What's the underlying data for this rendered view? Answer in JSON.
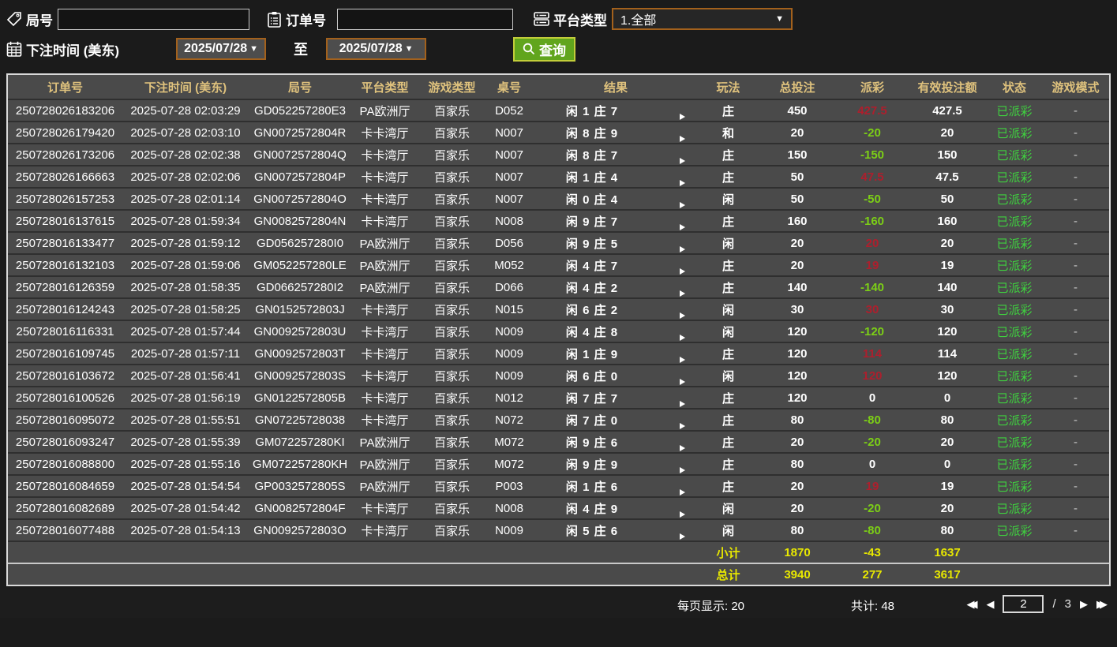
{
  "filters": {
    "game_no_label": "局号",
    "game_no_value": "",
    "order_no_label": "订单号",
    "order_no_value": "",
    "platform_label": "平台类型",
    "platform_value": "1.全部",
    "bet_time_label": "下注时间 (美东)",
    "date_from": "2025/07/28",
    "to_label": "至",
    "date_to": "2025/07/28",
    "search_label": "查询"
  },
  "colors": {
    "header_text": "#dfc27d",
    "win_red": "#ad1f2d",
    "loss_green": "#7ccf16",
    "status_green": "#3fd13f",
    "total_yellow": "#e8e800",
    "button_green": "#61a51d",
    "filter_border_orange": "#a3611c",
    "row_bg": "#4a4a4a",
    "page_bg": "#1b1b1b"
  },
  "table": {
    "headers": [
      "订单号",
      "下注时间 (美东)",
      "局号",
      "平台类型",
      "游戏类型",
      "桌号",
      "结果",
      "玩法",
      "总投注",
      "派彩",
      "有效投注额",
      "状态",
      "游戏模式"
    ],
    "rows": [
      {
        "order_id": "250728026183206",
        "bet_time": "2025-07-28 02:03:29",
        "game_no": "GD052257280E3",
        "platform": "PA欧洲厅",
        "game_type": "百家乐",
        "table_no": "D052",
        "result": "闲 1 庄 7",
        "play": "庄",
        "total_bet": "450",
        "payout": "427.5",
        "payout_color": "red",
        "valid_bet": "427.5",
        "status": "已派彩",
        "game_mode": "-"
      },
      {
        "order_id": "250728026179420",
        "bet_time": "2025-07-28 02:03:10",
        "game_no": "GN0072572804R",
        "platform": "卡卡湾厅",
        "game_type": "百家乐",
        "table_no": "N007",
        "result": "闲 8 庄 9",
        "play": "和",
        "total_bet": "20",
        "payout": "-20",
        "payout_color": "green",
        "valid_bet": "20",
        "status": "已派彩",
        "game_mode": "-"
      },
      {
        "order_id": "250728026173206",
        "bet_time": "2025-07-28 02:02:38",
        "game_no": "GN0072572804Q",
        "platform": "卡卡湾厅",
        "game_type": "百家乐",
        "table_no": "N007",
        "result": "闲 8 庄 7",
        "play": "庄",
        "total_bet": "150",
        "payout": "-150",
        "payout_color": "green",
        "valid_bet": "150",
        "status": "已派彩",
        "game_mode": "-"
      },
      {
        "order_id": "250728026166663",
        "bet_time": "2025-07-28 02:02:06",
        "game_no": "GN0072572804P",
        "platform": "卡卡湾厅",
        "game_type": "百家乐",
        "table_no": "N007",
        "result": "闲 1 庄 4",
        "play": "庄",
        "total_bet": "50",
        "payout": "47.5",
        "payout_color": "red",
        "valid_bet": "47.5",
        "status": "已派彩",
        "game_mode": "-"
      },
      {
        "order_id": "250728026157253",
        "bet_time": "2025-07-28 02:01:14",
        "game_no": "GN0072572804O",
        "platform": "卡卡湾厅",
        "game_type": "百家乐",
        "table_no": "N007",
        "result": "闲 0 庄 4",
        "play": "闲",
        "total_bet": "50",
        "payout": "-50",
        "payout_color": "green",
        "valid_bet": "50",
        "status": "已派彩",
        "game_mode": "-"
      },
      {
        "order_id": "250728016137615",
        "bet_time": "2025-07-28 01:59:34",
        "game_no": "GN0082572804N",
        "platform": "卡卡湾厅",
        "game_type": "百家乐",
        "table_no": "N008",
        "result": "闲 9 庄 7",
        "play": "庄",
        "total_bet": "160",
        "payout": "-160",
        "payout_color": "green",
        "valid_bet": "160",
        "status": "已派彩",
        "game_mode": "-"
      },
      {
        "order_id": "250728016133477",
        "bet_time": "2025-07-28 01:59:12",
        "game_no": "GD056257280I0",
        "platform": "PA欧洲厅",
        "game_type": "百家乐",
        "table_no": "D056",
        "result": "闲 9 庄 5",
        "play": "闲",
        "total_bet": "20",
        "payout": "20",
        "payout_color": "red",
        "valid_bet": "20",
        "status": "已派彩",
        "game_mode": "-"
      },
      {
        "order_id": "250728016132103",
        "bet_time": "2025-07-28 01:59:06",
        "game_no": "GM052257280LE",
        "platform": "PA欧洲厅",
        "game_type": "百家乐",
        "table_no": "M052",
        "result": "闲 4 庄 7",
        "play": "庄",
        "total_bet": "20",
        "payout": "19",
        "payout_color": "red",
        "valid_bet": "19",
        "status": "已派彩",
        "game_mode": "-"
      },
      {
        "order_id": "250728016126359",
        "bet_time": "2025-07-28 01:58:35",
        "game_no": "GD066257280I2",
        "platform": "PA欧洲厅",
        "game_type": "百家乐",
        "table_no": "D066",
        "result": "闲 4 庄 2",
        "play": "庄",
        "total_bet": "140",
        "payout": "-140",
        "payout_color": "green",
        "valid_bet": "140",
        "status": "已派彩",
        "game_mode": "-"
      },
      {
        "order_id": "250728016124243",
        "bet_time": "2025-07-28 01:58:25",
        "game_no": "GN0152572803J",
        "platform": "卡卡湾厅",
        "game_type": "百家乐",
        "table_no": "N015",
        "result": "闲 6 庄 2",
        "play": "闲",
        "total_bet": "30",
        "payout": "30",
        "payout_color": "red",
        "valid_bet": "30",
        "status": "已派彩",
        "game_mode": "-"
      },
      {
        "order_id": "250728016116331",
        "bet_time": "2025-07-28 01:57:44",
        "game_no": "GN0092572803U",
        "platform": "卡卡湾厅",
        "game_type": "百家乐",
        "table_no": "N009",
        "result": "闲 4 庄 8",
        "play": "闲",
        "total_bet": "120",
        "payout": "-120",
        "payout_color": "green",
        "valid_bet": "120",
        "status": "已派彩",
        "game_mode": "-"
      },
      {
        "order_id": "250728016109745",
        "bet_time": "2025-07-28 01:57:11",
        "game_no": "GN0092572803T",
        "platform": "卡卡湾厅",
        "game_type": "百家乐",
        "table_no": "N009",
        "result": "闲 1 庄 9",
        "play": "庄",
        "total_bet": "120",
        "payout": "114",
        "payout_color": "red",
        "valid_bet": "114",
        "status": "已派彩",
        "game_mode": "-"
      },
      {
        "order_id": "250728016103672",
        "bet_time": "2025-07-28 01:56:41",
        "game_no": "GN0092572803S",
        "platform": "卡卡湾厅",
        "game_type": "百家乐",
        "table_no": "N009",
        "result": "闲 6 庄 0",
        "play": "闲",
        "total_bet": "120",
        "payout": "120",
        "payout_color": "red",
        "valid_bet": "120",
        "status": "已派彩",
        "game_mode": "-"
      },
      {
        "order_id": "250728016100526",
        "bet_time": "2025-07-28 01:56:19",
        "game_no": "GN0122572805B",
        "platform": "卡卡湾厅",
        "game_type": "百家乐",
        "table_no": "N012",
        "result": "闲 7 庄 7",
        "play": "庄",
        "total_bet": "120",
        "payout": "0",
        "payout_color": "white",
        "valid_bet": "0",
        "status": "已派彩",
        "game_mode": "-"
      },
      {
        "order_id": "250728016095072",
        "bet_time": "2025-07-28 01:55:51",
        "game_no": "GN07225728038",
        "platform": "卡卡湾厅",
        "game_type": "百家乐",
        "table_no": "N072",
        "result": "闲 7 庄 0",
        "play": "庄",
        "total_bet": "80",
        "payout": "-80",
        "payout_color": "green",
        "valid_bet": "80",
        "status": "已派彩",
        "game_mode": "-"
      },
      {
        "order_id": "250728016093247",
        "bet_time": "2025-07-28 01:55:39",
        "game_no": "GM072257280KI",
        "platform": "PA欧洲厅",
        "game_type": "百家乐",
        "table_no": "M072",
        "result": "闲 9 庄 6",
        "play": "庄",
        "total_bet": "20",
        "payout": "-20",
        "payout_color": "green",
        "valid_bet": "20",
        "status": "已派彩",
        "game_mode": "-"
      },
      {
        "order_id": "250728016088800",
        "bet_time": "2025-07-28 01:55:16",
        "game_no": "GM072257280KH",
        "platform": "PA欧洲厅",
        "game_type": "百家乐",
        "table_no": "M072",
        "result": "闲 9 庄 9",
        "play": "庄",
        "total_bet": "80",
        "payout": "0",
        "payout_color": "white",
        "valid_bet": "0",
        "status": "已派彩",
        "game_mode": "-"
      },
      {
        "order_id": "250728016084659",
        "bet_time": "2025-07-28 01:54:54",
        "game_no": "GP0032572805S",
        "platform": "PA欧洲厅",
        "game_type": "百家乐",
        "table_no": "P003",
        "result": "闲 1 庄 6",
        "play": "庄",
        "total_bet": "20",
        "payout": "19",
        "payout_color": "red",
        "valid_bet": "19",
        "status": "已派彩",
        "game_mode": "-"
      },
      {
        "order_id": "250728016082689",
        "bet_time": "2025-07-28 01:54:42",
        "game_no": "GN0082572804F",
        "platform": "卡卡湾厅",
        "game_type": "百家乐",
        "table_no": "N008",
        "result": "闲 4 庄 9",
        "play": "闲",
        "total_bet": "20",
        "payout": "-20",
        "payout_color": "green",
        "valid_bet": "20",
        "status": "已派彩",
        "game_mode": "-"
      },
      {
        "order_id": "250728016077488",
        "bet_time": "2025-07-28 01:54:13",
        "game_no": "GN0092572803O",
        "platform": "卡卡湾厅",
        "game_type": "百家乐",
        "table_no": "N009",
        "result": "闲 5 庄 6",
        "play": "闲",
        "total_bet": "80",
        "payout": "-80",
        "payout_color": "green",
        "valid_bet": "80",
        "status": "已派彩",
        "game_mode": "-"
      }
    ],
    "subtotal": {
      "label": "小计",
      "total_bet": "1870",
      "payout": "-43",
      "valid_bet": "1637"
    },
    "grand_total": {
      "label": "总计",
      "total_bet": "3940",
      "payout": "277",
      "valid_bet": "3617"
    }
  },
  "footer": {
    "page_size_text": "每页显示: 20",
    "total_count_text": "共计: 48",
    "current_page": "2",
    "page_separator": "/",
    "total_pages": "3",
    "first_icon": "◀◀",
    "prev_icon": "◀",
    "next_icon": "▶",
    "last_icon": "▶▶"
  }
}
